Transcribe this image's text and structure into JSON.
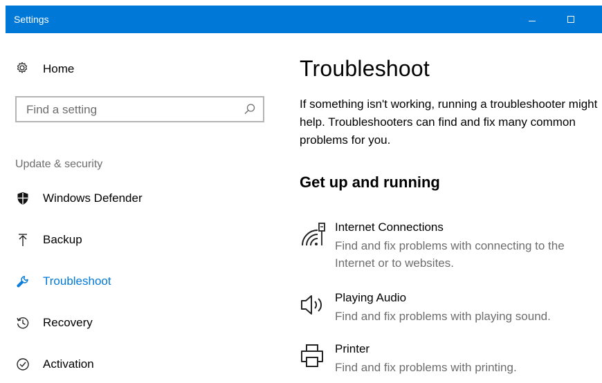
{
  "window": {
    "title": "Settings"
  },
  "sidebar": {
    "home_label": "Home",
    "search": {
      "placeholder": "Find a setting"
    },
    "section_label": "Update & security",
    "items": [
      {
        "label": "Windows Defender",
        "icon": "shield-icon"
      },
      {
        "label": "Backup",
        "icon": "backup-arrow-icon"
      },
      {
        "label": "Troubleshoot",
        "icon": "wrench-icon",
        "active": true
      },
      {
        "label": "Recovery",
        "icon": "history-icon"
      },
      {
        "label": "Activation",
        "icon": "checkmark-circle-icon"
      }
    ]
  },
  "main": {
    "title": "Troubleshoot",
    "description": "If something isn't working, running a troubleshooter might help. Troubleshooters can find and fix many common problems for you.",
    "section_heading": "Get up and running",
    "troubleshooters": [
      {
        "name": "Internet Connections",
        "description": "Find and fix problems with connecting to the Internet or to websites.",
        "icon": "network-icon"
      },
      {
        "name": "Playing Audio",
        "description": "Find and fix problems with playing sound.",
        "icon": "speaker-icon"
      },
      {
        "name": "Printer",
        "description": "Find and fix problems with printing.",
        "icon": "printer-icon"
      }
    ]
  },
  "colors": {
    "accent": "#0078d7",
    "secondary_text": "#6d6d6d"
  }
}
